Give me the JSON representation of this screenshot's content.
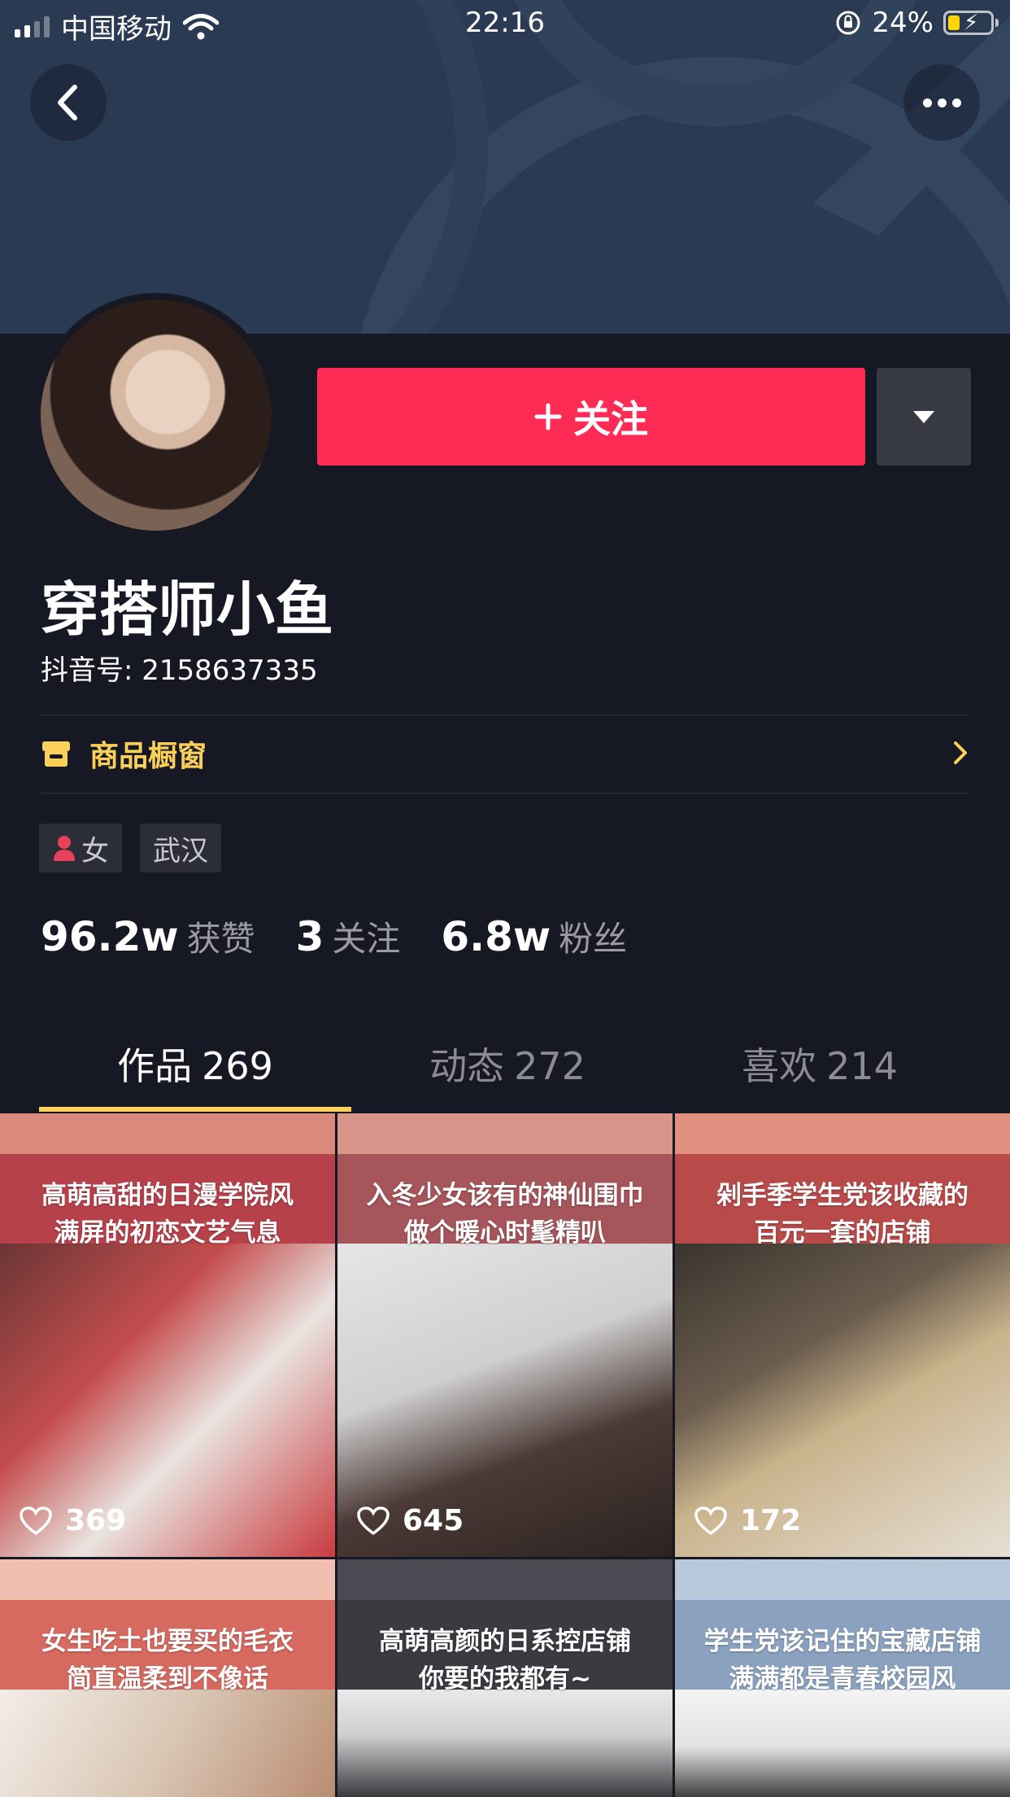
{
  "status_bar": {
    "carrier": "中国移动",
    "time": "22:16",
    "battery": "24%"
  },
  "profile": {
    "follow_label": "关注",
    "nickname": "穿搭师小鱼",
    "douyin_id": "抖音号: 2158637335",
    "shop_label": "商品橱窗",
    "tags": {
      "gender": "女",
      "city": "武汉"
    },
    "stats": [
      {
        "num": "96.2w",
        "label": "获赞"
      },
      {
        "num": "3",
        "label": "关注"
      },
      {
        "num": "6.8w",
        "label": "粉丝"
      }
    ]
  },
  "tabs": [
    {
      "label": "作品",
      "count": "269"
    },
    {
      "label": "动态",
      "count": "272"
    },
    {
      "label": "喜欢",
      "count": "214"
    }
  ],
  "videos": [
    {
      "line1": "高萌高甜的日漫学院风",
      "line2": "满屏的初恋文艺气息",
      "likes": "369"
    },
    {
      "line1": "入冬少女该有的神仙围巾",
      "line2": "做个暖心时髦精叭",
      "likes": "645"
    },
    {
      "line1": "剁手季学生党该收藏的",
      "line2": "百元一套的店铺",
      "likes": "172"
    },
    {
      "line1": "女生吃土也要买的毛衣",
      "line2": "简直温柔到不像话",
      "likes": ""
    },
    {
      "line1": "高萌高颜的日系控店铺",
      "line2": "你要的我都有~",
      "likes": ""
    },
    {
      "line1": "学生党该记住的宝藏店铺",
      "line2": "满满都是青春校园风",
      "likes": ""
    }
  ],
  "colors": {
    "accent": "#fe2c55",
    "gold": "#facf5a",
    "background": "#161823"
  }
}
